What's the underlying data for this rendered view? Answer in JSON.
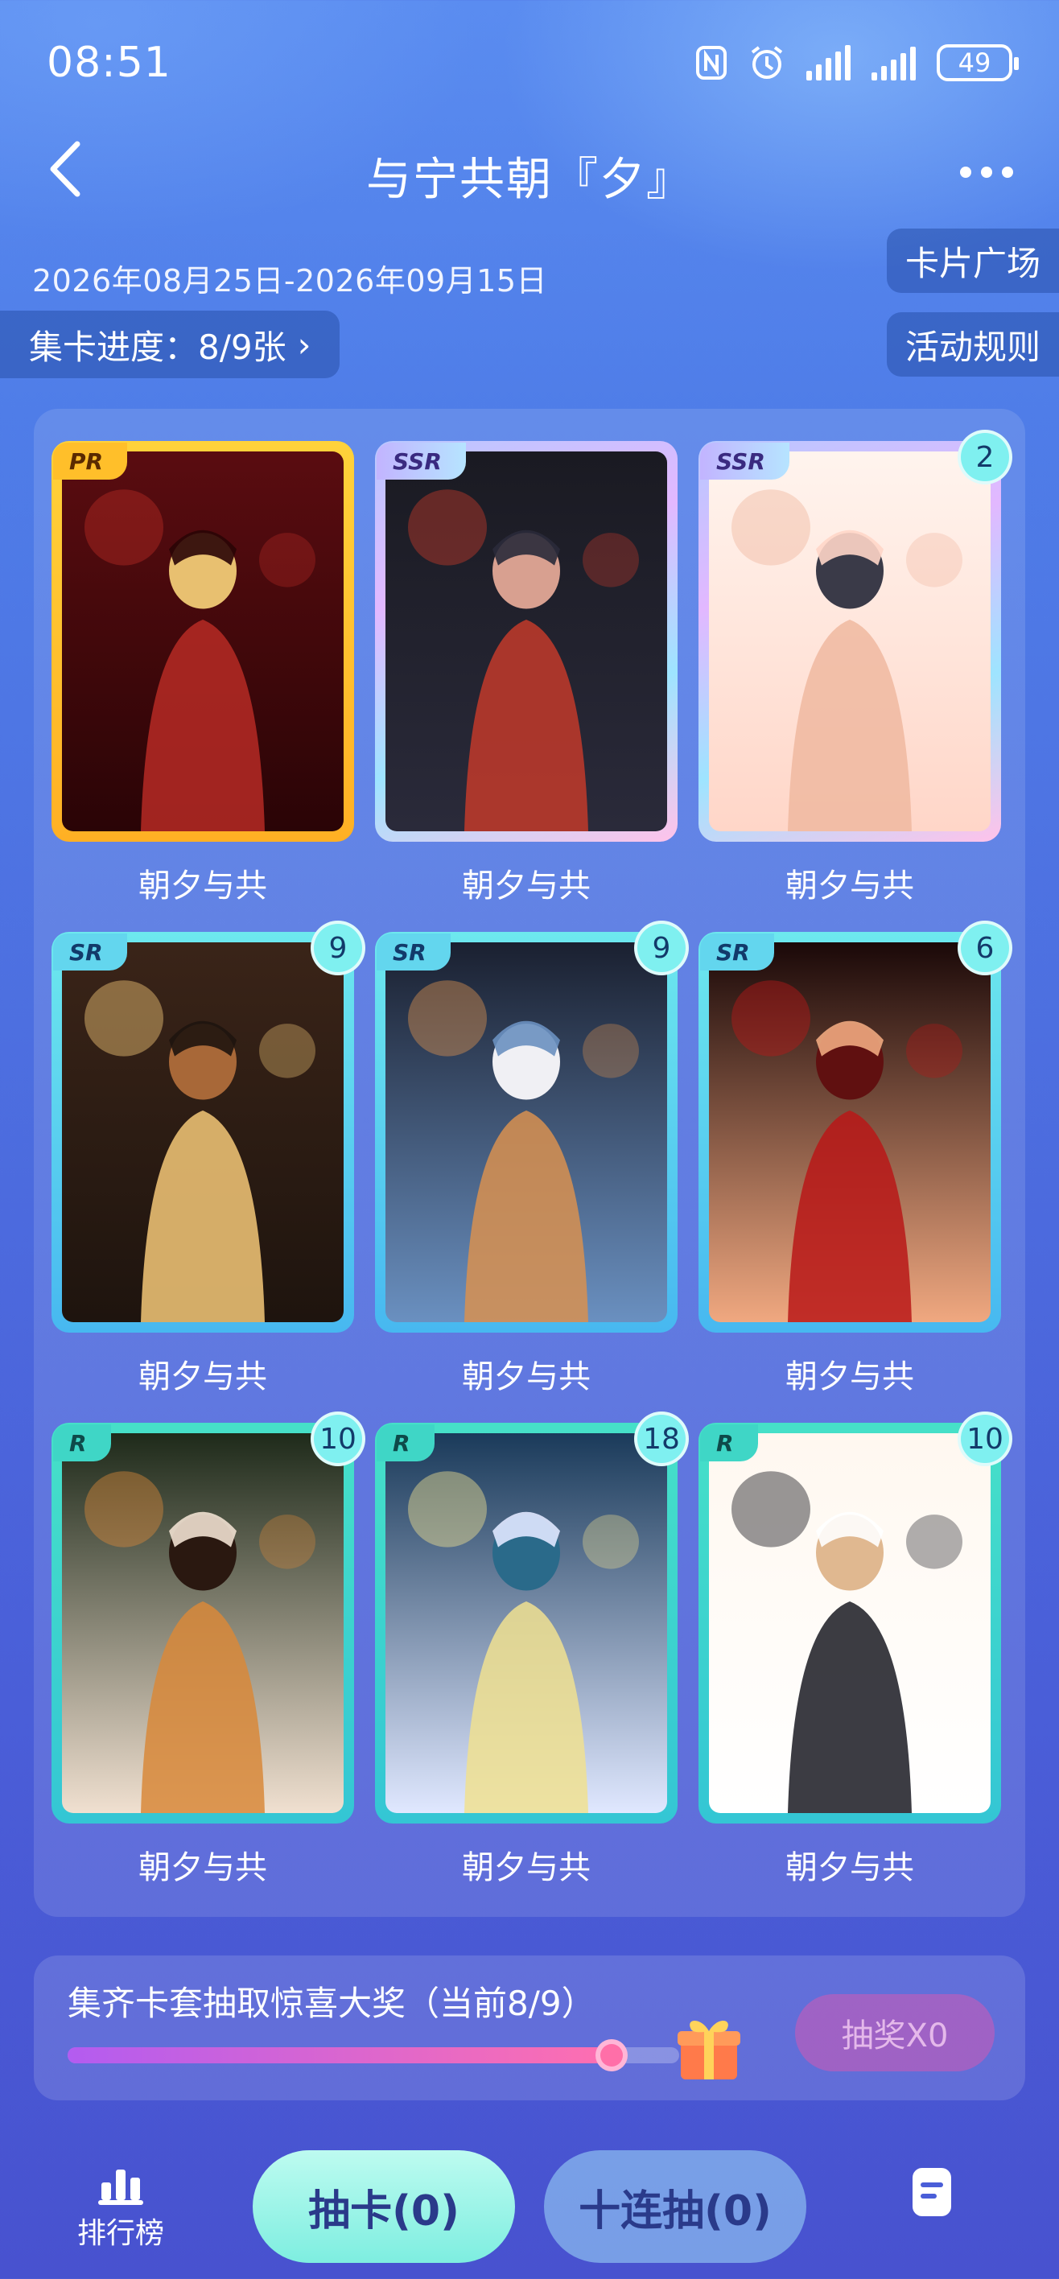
{
  "status_bar": {
    "time": "08:51",
    "battery": "49"
  },
  "header": {
    "title": "与宁共朝『夕』"
  },
  "event": {
    "date_range": "2026年08月25日-2026年09月15日",
    "progress_label": "集卡进度：8/9张",
    "card_square_label": "卡片广场",
    "rules_label": "活动规则"
  },
  "cards": [
    {
      "rarity": "PR",
      "count": "",
      "name": "朝夕与共"
    },
    {
      "rarity": "SSR",
      "count": "",
      "name": "朝夕与共"
    },
    {
      "rarity": "SSR",
      "count": "2",
      "name": "朝夕与共"
    },
    {
      "rarity": "SR",
      "count": "9",
      "name": "朝夕与共"
    },
    {
      "rarity": "SR",
      "count": "9",
      "name": "朝夕与共"
    },
    {
      "rarity": "SR",
      "count": "6",
      "name": "朝夕与共"
    },
    {
      "rarity": "R",
      "count": "10",
      "name": "朝夕与共"
    },
    {
      "rarity": "R",
      "count": "18",
      "name": "朝夕与共"
    },
    {
      "rarity": "R",
      "count": "10",
      "name": "朝夕与共"
    }
  ],
  "lottery": {
    "text": "集齐卡套抽取惊喜大奖（当前8/9）",
    "progress": 0.889,
    "button_label": "抽奖X0"
  },
  "bottom_nav": {
    "rank_label": "排行榜",
    "draw_label": "抽卡(0)",
    "ten_draw_label": "十连抽(0)"
  },
  "colors": {
    "pr_frame": "#ffc22a",
    "sr_frame": "#5fd2ee",
    "r_frame": "#3fd6c6",
    "badge": "#7ff0f0"
  }
}
